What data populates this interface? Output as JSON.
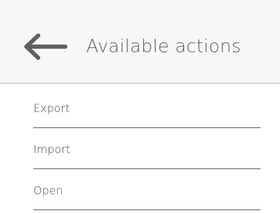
{
  "header": {
    "title": "Available actions",
    "back_icon": "arrow-left-icon"
  },
  "actions": [
    {
      "label": "Export"
    },
    {
      "label": "Import"
    },
    {
      "label": "Open"
    }
  ],
  "colors": {
    "header_background": "#f7f7f7",
    "text": "#5f5f5f",
    "divider": "#5a5a5a"
  }
}
